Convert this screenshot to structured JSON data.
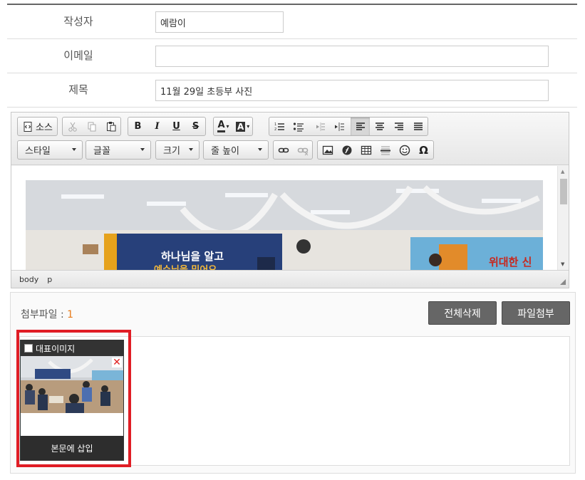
{
  "form": {
    "author_label": "작성자",
    "author_value": "예람이",
    "email_label": "이메일",
    "email_value": "",
    "subject_label": "제목",
    "subject_value": "11월 29일 초등부 사진"
  },
  "toolbar": {
    "source_label": "소스",
    "bold": "B",
    "italic": "I",
    "underline": "U",
    "strike": "S",
    "text_color": "A",
    "bg_color": "A",
    "special_char": "Ω",
    "style_combo": "스타일",
    "font_combo": "글꼴",
    "size_combo": "크기",
    "lineheight_combo": "줄 높이"
  },
  "content": {
    "banner_text_1": "하나님을 알고",
    "banner_text_2": "예수님을 믿어요",
    "banner_text_3": "위대한 신"
  },
  "statusbar": {
    "path_body": "body",
    "path_p": "p"
  },
  "attach": {
    "label": "첨부파일 : ",
    "count": "1",
    "delete_all": "전체삭제",
    "add_file": "파일첨부",
    "rep_image": "대표이미지",
    "remove": "✕",
    "insert": "본문에 삽입"
  },
  "colors": {
    "highlight": "#e01d25",
    "count": "#e87b1a",
    "dark_button": "#666666"
  }
}
